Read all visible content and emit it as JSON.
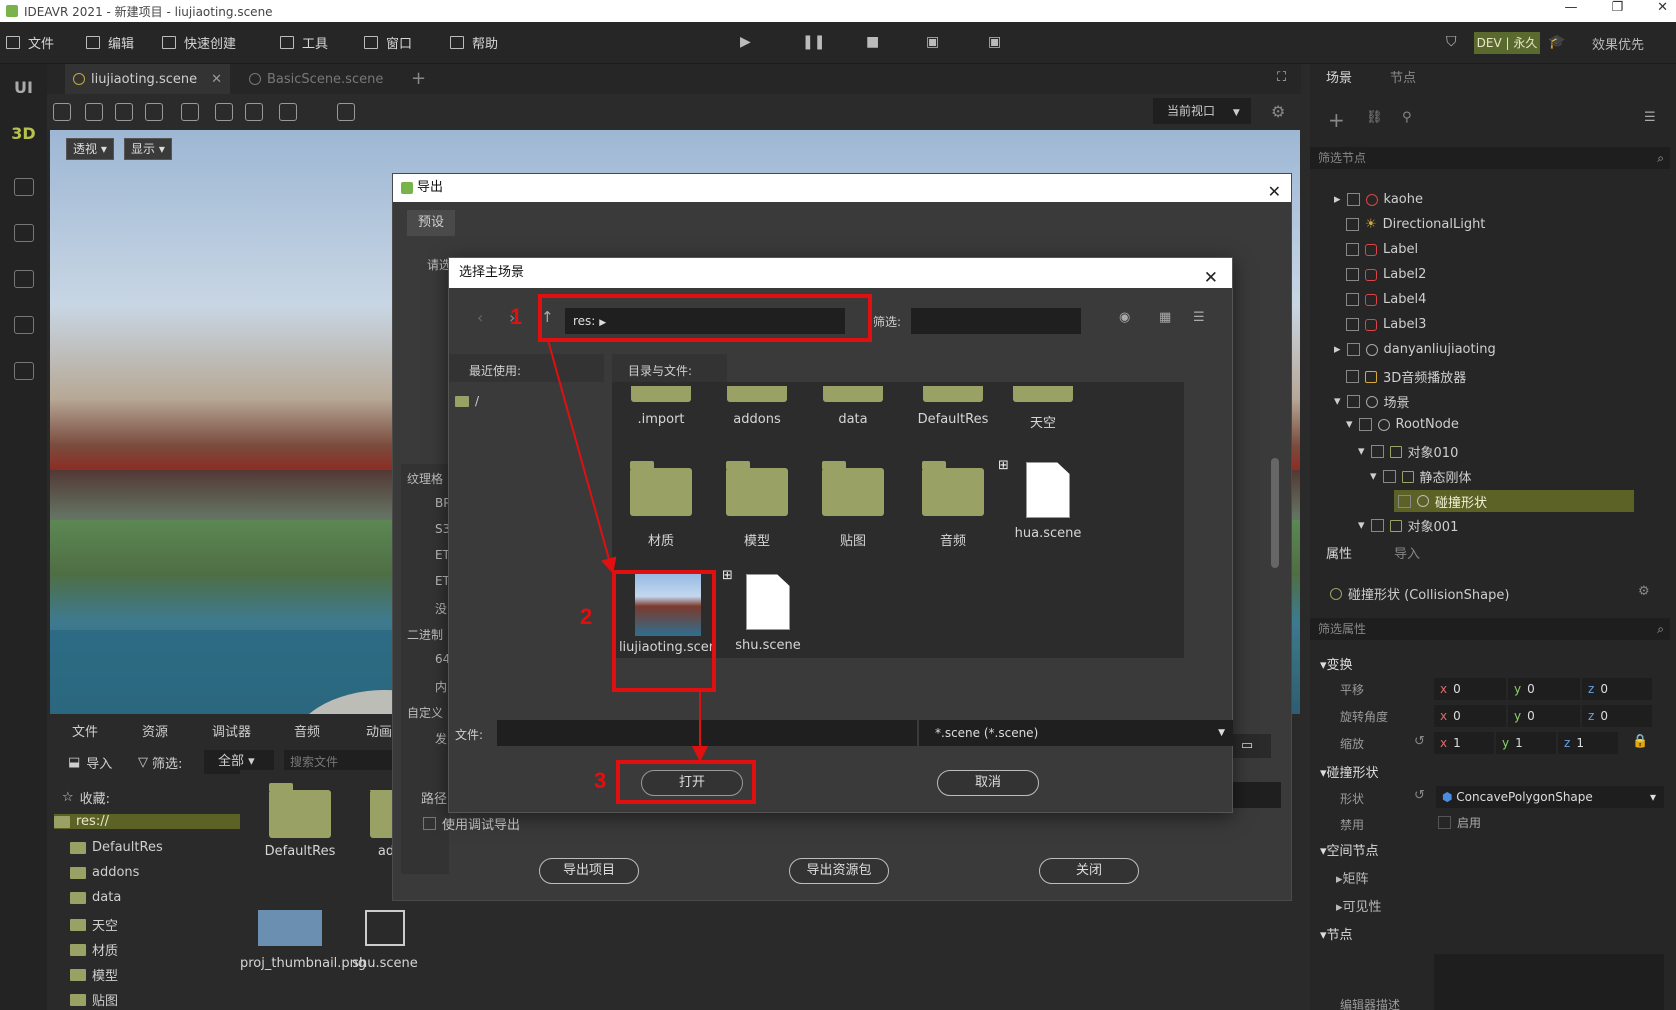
{
  "window": {
    "title": "IDEAVR 2021 - 新建项目 - liujiaoting.scene",
    "min": "—",
    "max": "❐",
    "close": "✕"
  },
  "menu": {
    "items": [
      "文件",
      "编辑",
      "快速创建",
      "工具",
      "窗口",
      "帮助"
    ],
    "dev_badge": "DEV | 永久",
    "effect": "效果优先"
  },
  "left_strip": {
    "ui": "UI",
    "3d": "3D"
  },
  "tabs": [
    "liujiaoting.scene",
    "BasicScene.scene"
  ],
  "viewport": {
    "view_select": "当前视口",
    "persp": "透视",
    "display": "显示"
  },
  "bottom": {
    "tabs": [
      "文件",
      "资源",
      "调试器",
      "音频",
      "动画"
    ],
    "import": "导入",
    "filter": "筛选:",
    "filter_value": "全部",
    "search_placeholder": "搜索文件",
    "favorites": "收藏:",
    "tree": [
      "res://",
      "DefaultRes",
      "addons",
      "data",
      "天空",
      "材质",
      "模型",
      "贴图"
    ],
    "grid": [
      "DefaultRes",
      "proj_thumbnail.png",
      "shu.scene",
      "ad"
    ]
  },
  "right": {
    "tabs": [
      "场景",
      "节点"
    ],
    "filter_nodes": "筛选节点",
    "nodes": [
      "kaohe",
      "DirectionalLight",
      "Label",
      "Label2",
      "Label4",
      "Label3",
      "danyanliujiaoting",
      "3D音频播放器",
      "场景",
      "RootNode",
      "对象010",
      "静态刚体",
      "碰撞形状",
      "对象001"
    ],
    "prop_tabs": [
      "属性",
      "导入"
    ],
    "shape_title": "碰撞形状 (CollisionShape)",
    "filter_props": "筛选属性",
    "transform": "变换",
    "translate": "平移",
    "rotate": "旋转角度",
    "scale": "缩放",
    "t": [
      "0",
      "0",
      "0"
    ],
    "r": [
      "0",
      "0",
      "0"
    ],
    "s": [
      "1",
      "1",
      "1"
    ],
    "collision": "碰撞形状",
    "shape_label": "形状",
    "shape_value": "ConcavePolygonShape",
    "disabled_label": "禁用",
    "enable": "启用",
    "spatial": "空间节点",
    "matrix": "矩阵",
    "visible": "可见性",
    "node": "节点",
    "edit_desc": "编辑器描述"
  },
  "export": {
    "title": "导出",
    "preset_tab": "预设",
    "hint": "请选",
    "side": [
      "纹理格",
      "BP",
      "S3",
      "ET",
      "ET",
      "没",
      "二进制",
      "64",
      "内",
      "自定义",
      "发"
    ],
    "path_label": "路径",
    "debug_export": "使用调试导出",
    "btn_export": "导出项目",
    "btn_pack": "导出资源包",
    "btn_close": "关闭"
  },
  "select": {
    "title": "选择主场景",
    "path": "res:",
    "filter_label": "筛选:",
    "recent": "最近使用:",
    "recent_item": "/",
    "dir_label": "目录与文件:",
    "row1": [
      ".import",
      "addons",
      "data",
      "DefaultRes",
      "天空"
    ],
    "row2": [
      "材质",
      "模型",
      "贴图",
      "音频",
      "hua.scene"
    ],
    "row3": [
      "liujiaoting.scene",
      "shu.scene"
    ],
    "file_label": "文件:",
    "file_type": "*.scene (*.scene)",
    "open": "打开",
    "cancel": "取消"
  },
  "annotations": [
    "1",
    "2",
    "3"
  ]
}
